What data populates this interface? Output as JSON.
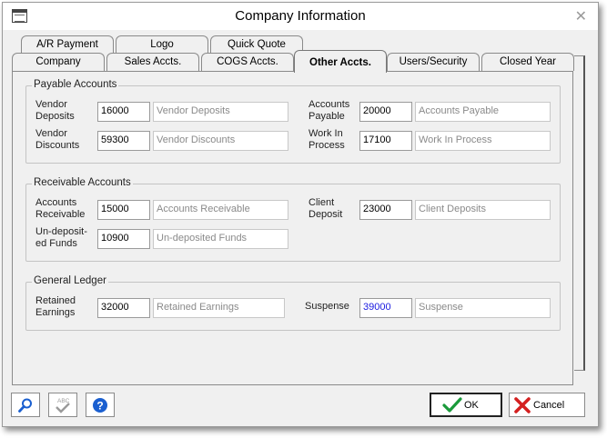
{
  "window": {
    "title": "Company Information",
    "close_symbol": "✕"
  },
  "tabs_back": [
    "A/R Payment",
    "Logo",
    "Quick Quote"
  ],
  "tabs_front": [
    "Company",
    "Sales Accts.",
    "COGS Accts.",
    "Other Accts.",
    "Users/Security",
    "Closed Year"
  ],
  "active_tab": "Other Accts.",
  "payable": {
    "legend": "Payable Accounts",
    "vendor_deposits": {
      "label_1": "Vendor",
      "label_2": "Deposits",
      "value": "16000",
      "desc": "Vendor Deposits"
    },
    "vendor_discounts": {
      "label_1": "Vendor",
      "label_2": "Discounts",
      "value": "59300",
      "desc": "Vendor Discounts"
    },
    "accounts_payable": {
      "label_1": "Accounts",
      "label_2": "Payable",
      "value": "20000",
      "desc": "Accounts Payable"
    },
    "work_in_process": {
      "label_1": "Work In",
      "label_2": "Process",
      "value": "17100",
      "desc": "Work In Process"
    }
  },
  "receivable": {
    "legend": "Receivable Accounts",
    "accounts_receivable": {
      "label_1": "Accounts",
      "label_2": "Receivable",
      "value": "15000",
      "desc": "Accounts Receivable"
    },
    "undeposited_funds": {
      "label_1": "Un-deposit-",
      "label_2": "ed Funds",
      "value": "10900",
      "desc": "Un-deposited Funds"
    },
    "client_deposit": {
      "label_1": "Client",
      "label_2": "Deposit",
      "value": "23000",
      "desc": "Client Deposits"
    }
  },
  "ledger": {
    "legend": "General Ledger",
    "retained_earnings": {
      "label_1": "Retained",
      "label_2": "Earnings",
      "value": "32000",
      "desc": "Retained Earnings"
    },
    "suspense": {
      "label": "Suspense",
      "value": "39000",
      "desc": "Suspense"
    }
  },
  "footer": {
    "ok_label": "OK",
    "cancel_label": "Cancel",
    "abc_label": "ABC"
  },
  "colors": {
    "ok_check": "#1a9a3a",
    "cancel_x": "#d42020",
    "help_blue": "#1a5fd0",
    "suspense_value": "#1a1ae0"
  }
}
